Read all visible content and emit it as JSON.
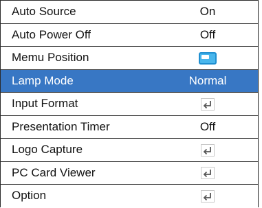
{
  "menu": {
    "items": [
      {
        "label": "Auto Source",
        "value": "On"
      },
      {
        "label": "Auto Power Off",
        "value": "Off"
      },
      {
        "label": "Memu Position",
        "value_icon": "menu-position-icon"
      },
      {
        "label": "Lamp Mode",
        "value": "Normal",
        "selected": true
      },
      {
        "label": "Input Format",
        "value_icon": "enter-icon"
      },
      {
        "label": "Presentation Timer",
        "value": "Off"
      },
      {
        "label": "Logo Capture",
        "value_icon": "enter-icon"
      },
      {
        "label": "PC Card Viewer",
        "value_icon": "enter-icon"
      },
      {
        "label": "Option",
        "value_icon": "enter-icon"
      }
    ]
  },
  "colors": {
    "selected_bg": "#3877c4",
    "border": "#2a2a2a",
    "position_icon": "#49b6ec"
  }
}
